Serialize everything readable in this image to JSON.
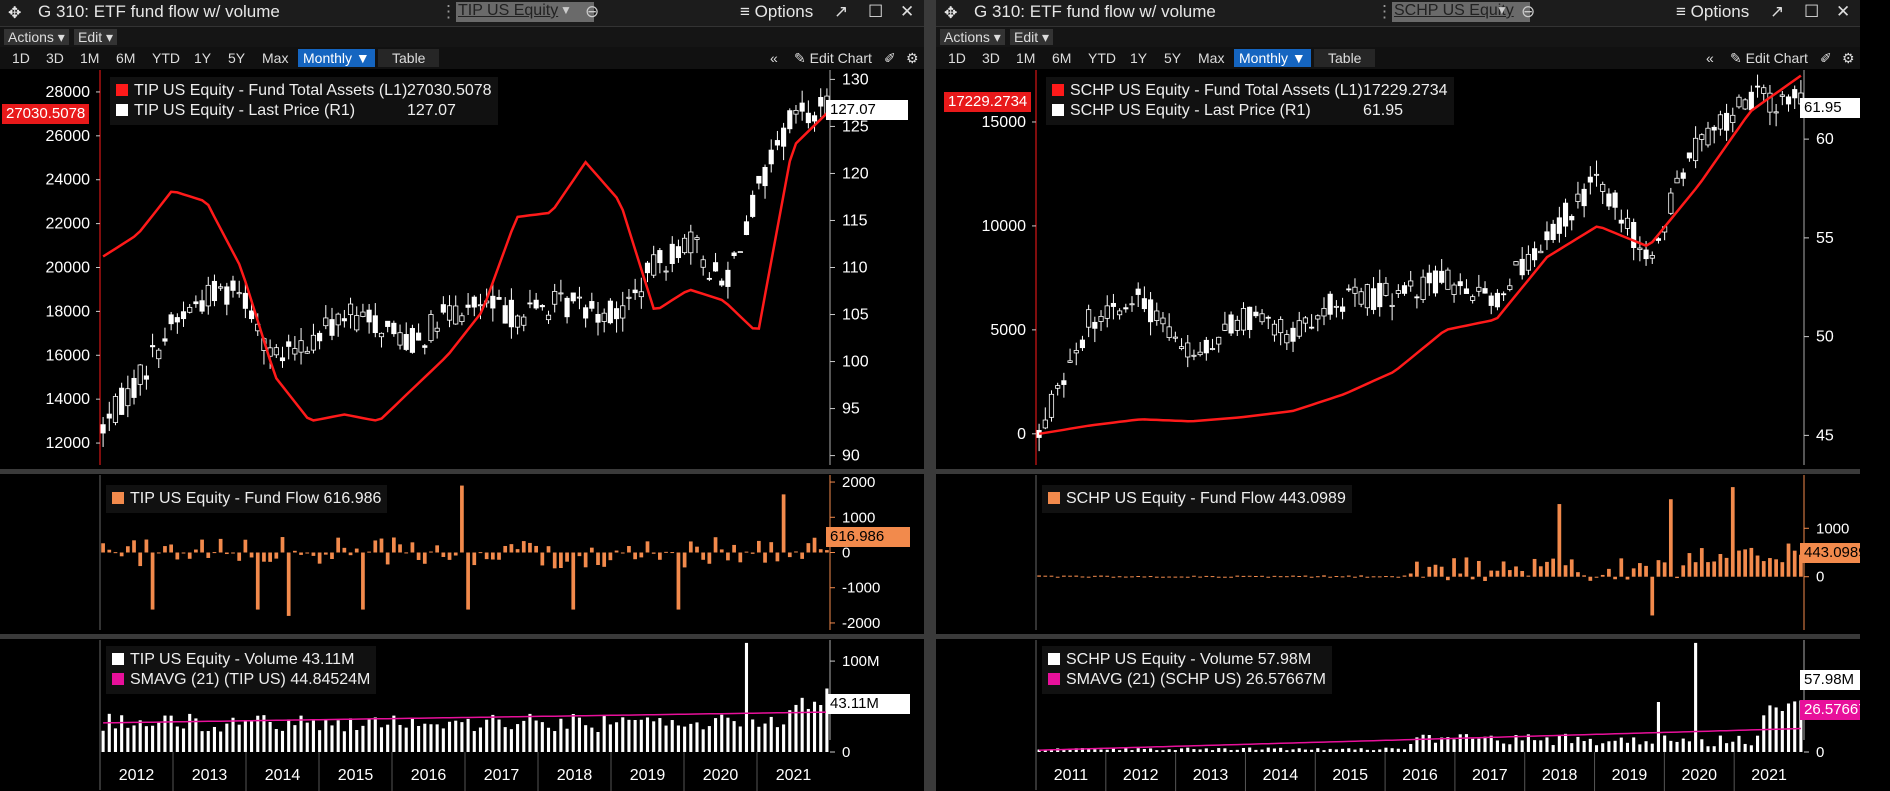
{
  "panels": [
    {
      "id": "tip",
      "title": "G 310: ETF fund flow w/ volume",
      "ticker": "TIP US Equity",
      "options_label": "Options",
      "menu": [
        "Actions ▾",
        "Edit ▾"
      ],
      "timeframes": [
        "1D",
        "3D",
        "1M",
        "6M",
        "YTD",
        "1Y",
        "5Y",
        "Max"
      ],
      "period_label": "Monthly ▼",
      "table_label": "Table",
      "edit_chart_label": "Edit Chart",
      "legend_top": [
        {
          "label": "TIP US Equity - Fund Total Assets (L1)",
          "value": "27030.5078",
          "color": "#ff1a1a"
        },
        {
          "label": "TIP US Equity - Last Price (R1)",
          "value": "127.07",
          "color": "#ffffff"
        }
      ],
      "legend_flow": {
        "label": "TIP US Equity - Fund Flow 616.986",
        "color": "#f28a4c"
      },
      "legend_vol": [
        {
          "label": "TIP US Equity - Volume 43.11M",
          "color": "#ffffff"
        },
        {
          "label": "SMAVG (21) (TIP US)    44.84524M",
          "color": "#e8109b"
        }
      ],
      "tags": {
        "assets": "27030.5078",
        "price": "127.07",
        "flow": "616.986",
        "vol": "43.11M"
      },
      "x_labels": [
        "2012",
        "2013",
        "2014",
        "2015",
        "2016",
        "2017",
        "2018",
        "2019",
        "2020",
        "2021"
      ]
    },
    {
      "id": "schp",
      "title": "G 310: ETF fund flow w/ volume",
      "ticker": "SCHP US Equity",
      "options_label": "Options",
      "menu": [
        "Actions ▾",
        "Edit ▾"
      ],
      "timeframes": [
        "1D",
        "3D",
        "1M",
        "6M",
        "YTD",
        "1Y",
        "5Y",
        "Max"
      ],
      "period_label": "Monthly ▼",
      "table_label": "Table",
      "edit_chart_label": "Edit Chart",
      "legend_top": [
        {
          "label": "SCHP US Equity - Fund Total Assets (L1)",
          "value": "17229.2734",
          "color": "#ff1a1a"
        },
        {
          "label": "SCHP US Equity - Last Price (R1)",
          "value": "61.95",
          "color": "#ffffff"
        }
      ],
      "legend_flow": {
        "label": "SCHP US Equity - Fund Flow 443.0989",
        "color": "#f28a4c"
      },
      "legend_vol": [
        {
          "label": "SCHP US Equity - Volume 57.98M",
          "color": "#ffffff"
        },
        {
          "label": "SMAVG (21) (SCHP US)    26.57667M",
          "color": "#e8109b"
        }
      ],
      "tags": {
        "assets": "17229.2734",
        "price": "61.95",
        "flow": "443.0989",
        "vol": "57.98M",
        "sma": "26.57667M"
      },
      "x_labels": [
        "2011",
        "2012",
        "2013",
        "2014",
        "2015",
        "2016",
        "2017",
        "2018",
        "2019",
        "2020",
        "2021"
      ]
    }
  ],
  "chart_data": [
    {
      "type": "line",
      "title": "TIP US Equity - Fund Total Assets / Last Price",
      "x": [
        "2011-06",
        "2011-12",
        "2012-06",
        "2012-12",
        "2013-06",
        "2013-12",
        "2014-06",
        "2014-12",
        "2015-06",
        "2015-12",
        "2016-06",
        "2016-12",
        "2017-06",
        "2017-12",
        "2018-06",
        "2018-12",
        "2019-06",
        "2019-12",
        "2020-03",
        "2020-06",
        "2020-12",
        "2021-02"
      ],
      "series": [
        {
          "name": "TIP US Equity - Fund Total Assets (L1)",
          "axis": "left",
          "values": [
            20500,
            21500,
            23500,
            23000,
            20000,
            15000,
            13000,
            13300,
            13000,
            14500,
            16000,
            18000,
            22300,
            22500,
            24800,
            23000,
            18000,
            19000,
            18500,
            17000,
            25500,
            27030
          ]
        },
        {
          "name": "TIP US Equity - Last Price (R1)",
          "axis": "right",
          "values": [
            93,
            98,
            104,
            107,
            108,
            100,
            102,
            105,
            104,
            102,
            105,
            106,
            105,
            106,
            106,
            105,
            110,
            113,
            108,
            118,
            126,
            127.07
          ]
        }
      ],
      "ylim_left": [
        11000,
        29000
      ],
      "yticks_left": [
        12000,
        14000,
        16000,
        18000,
        20000,
        22000,
        24000,
        26000,
        28000
      ],
      "ylim_right": [
        89,
        131
      ],
      "yticks_right": [
        90,
        95,
        100,
        105,
        110,
        115,
        120,
        125,
        130
      ],
      "flow": {
        "ylim": [
          -2200,
          2200
        ],
        "yticks": [
          -2000,
          -1000,
          0,
          1000,
          2000
        ],
        "peak_max": 1900,
        "peak_min": -1800,
        "last": 616.986
      },
      "volume": {
        "yticks": [
          "0",
          "50M",
          "100M"
        ],
        "ylim": [
          0,
          110
        ],
        "max": 125,
        "sma_last": 44.84524,
        "last": 43.11
      }
    },
    {
      "type": "line",
      "title": "SCHP US Equity - Fund Total Assets / Last Price",
      "x": [
        "2011-01",
        "2012-01",
        "2013-01",
        "2014-01",
        "2015-01",
        "2016-01",
        "2017-01",
        "2018-01",
        "2018-06",
        "2019-01",
        "2019-06",
        "2020-01",
        "2020-03",
        "2020-06",
        "2021-01",
        "2021-03"
      ],
      "series": [
        {
          "name": "SCHP US Equity - Fund Total Assets (L1)",
          "axis": "left",
          "values": [
            0,
            400,
            700,
            600,
            800,
            1100,
            1900,
            3000,
            5000,
            5500,
            8500,
            10000,
            9000,
            12000,
            15500,
            17229.2734
          ]
        },
        {
          "name": "SCHP US Equity - Last Price (R1)",
          "axis": "right",
          "values": [
            45,
            51,
            52,
            49,
            51,
            50,
            52,
            52,
            53,
            52,
            55,
            58,
            54,
            60,
            62,
            61.95
          ]
        }
      ],
      "ylim_left": [
        -1500,
        17500
      ],
      "yticks_left": [
        0,
        5000,
        10000,
        15000
      ],
      "ylim_right": [
        43.5,
        63.5
      ],
      "yticks_right": [
        45,
        50,
        55,
        60
      ],
      "flow": {
        "ylim": [
          -1100,
          2100
        ],
        "yticks": [
          0,
          1000
        ],
        "peak_max": 1600,
        "peak_min": -800,
        "last": 443.0989
      },
      "volume": {
        "yticks": [
          "0"
        ],
        "ylim": [
          0,
          110
        ],
        "max": 125,
        "sma_last": 26.57667,
        "last": 57.98
      }
    }
  ]
}
